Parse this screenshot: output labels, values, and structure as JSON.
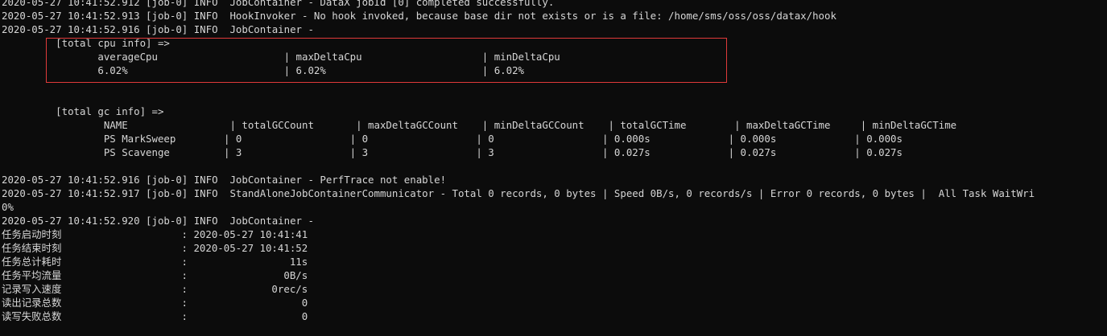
{
  "terminal": {
    "lines": [
      "2020-05-27 10:41:52.912 [job-0] INFO  JobContainer - DataX jobId [0] completed successfully.",
      "2020-05-27 10:41:52.913 [job-0] INFO  HookInvoker - No hook invoked, because base dir not exists or is a file: /home/sms/oss/oss/datax/hook",
      "2020-05-27 10:41:52.916 [job-0] INFO  JobContainer - ",
      "\t [total cpu info] => ",
      "\t\taverageCpu                     | maxDeltaCpu                    | minDeltaCpu                    ",
      "\t\t6.02%                          | 6.02%                          | 6.02%                          ",
      "",
      "",
      "\t [total gc info] => ",
      "\t\t NAME                 | totalGCCount       | maxDeltaGCCount    | minDeltaGCCount    | totalGCTime        | maxDeltaGCTime     | minDeltaGCTime     ",
      "\t\t PS MarkSweep        | 0                  | 0                  | 0                  | 0.000s             | 0.000s             | 0.000s             ",
      "\t\t PS Scavenge         | 3                  | 3                  | 3                  | 0.027s             | 0.027s             | 0.027s             ",
      "",
      "2020-05-27 10:41:52.916 [job-0] INFO  JobContainer - PerfTrace not enable!",
      "2020-05-27 10:41:52.917 [job-0] INFO  StandAloneJobContainerCommunicator - Total 0 records, 0 bytes | Speed 0B/s, 0 records/s | Error 0 records, 0 bytes |  All Task WaitWri",
      "0%",
      "2020-05-27 10:41:52.920 [job-0] INFO  JobContainer - ",
      "任务启动时刻                    : 2020-05-27 10:41:41",
      "任务结束时刻                    : 2020-05-27 10:41:52",
      "任务总计耗时                    :                 11s",
      "任务平均流量                    :                0B/s",
      "记录写入速度                    :              0rec/s",
      "读出记录总数                    :                   0",
      "读写失败总数                    :                   0"
    ],
    "highlight_color": "#e03a3a",
    "text_color": "#d6d6d6",
    "background_color": "#0c0c0c"
  }
}
